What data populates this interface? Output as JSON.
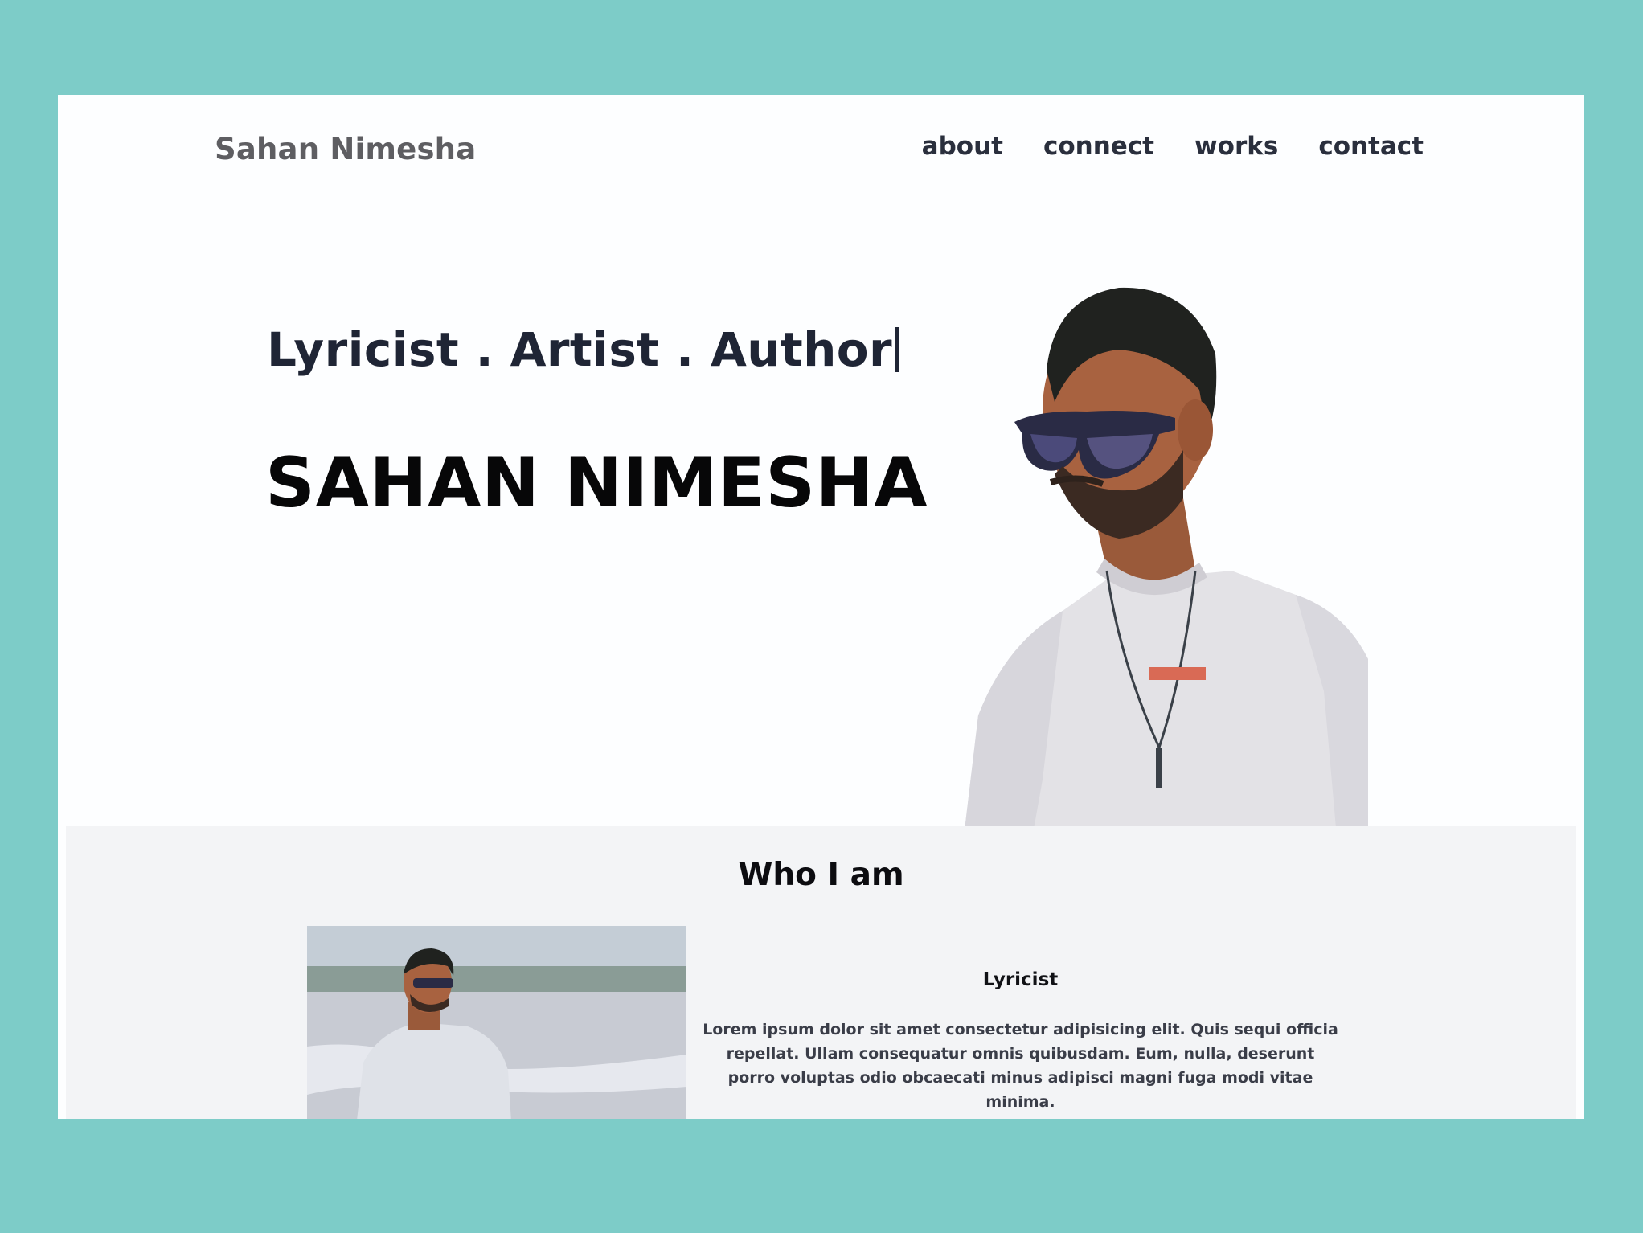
{
  "nav": {
    "brand": "Sahan Nimesha",
    "links": [
      "about",
      "connect",
      "works",
      "contact"
    ]
  },
  "hero": {
    "tagline": "Lyricist . Artist . Author",
    "name": "SAHAN NIMESHA"
  },
  "who": {
    "title": "Who I am",
    "role_title": "Lyricist",
    "role_desc": "Lorem ipsum dolor sit amet consectetur adipisicing elit. Quis sequi officia repellat. Ullam consequatur omnis quibusdam. Eum, nulla, deserunt porro voluptas odio obcaecati minus adipisci magni fuga modi vitae minima."
  },
  "colors": {
    "page_background": "#7dccc8",
    "screen_background": "#fdfeff",
    "section_background": "#f3f4f6",
    "tagline": "#1f2535",
    "heading": "#070708"
  }
}
